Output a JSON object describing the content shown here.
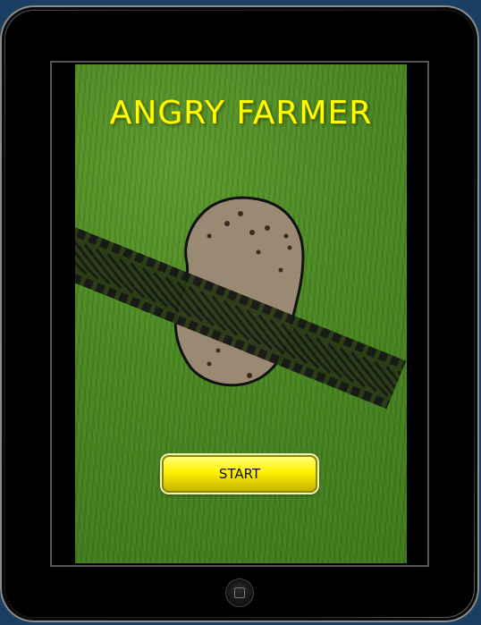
{
  "game": {
    "title": "ANGRY FARMER",
    "start_label": "START"
  },
  "scene": {
    "icons": [
      "potato-icon",
      "tire-track-icon"
    ]
  },
  "colors": {
    "title": "#ffff00",
    "button": "#fff200",
    "grass": "#4c8a23",
    "potato": "#9b8a73"
  }
}
